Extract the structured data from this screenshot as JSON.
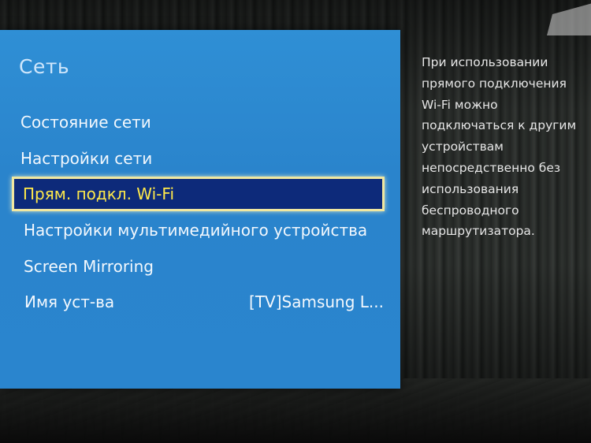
{
  "menu": {
    "title": "Сеть",
    "items": [
      {
        "label": "Состояние сети",
        "value": ""
      },
      {
        "label": "Настройки сети",
        "value": ""
      },
      {
        "label": "Прям. подкл. Wi-Fi",
        "value": "",
        "selected": true
      },
      {
        "label": "Настройки мультимедийного устройства",
        "value": ""
      },
      {
        "label": "Screen Mirroring",
        "value": ""
      },
      {
        "label": "Имя уст-ва",
        "value": "[TV]Samsung L..."
      }
    ]
  },
  "description": {
    "lines": [
      "При использовании",
      "прямого подключения",
      "Wi-Fi можно",
      "подключаться к другим",
      "устройствам",
      "непосредственно без",
      "использования",
      "беспроводного",
      "маршрутизатора."
    ]
  },
  "colors": {
    "panel": "#2a85ce",
    "selection_bg": "#0d2a7a",
    "selection_text": "#ffe94a",
    "selection_border": "#f0e7a0"
  }
}
